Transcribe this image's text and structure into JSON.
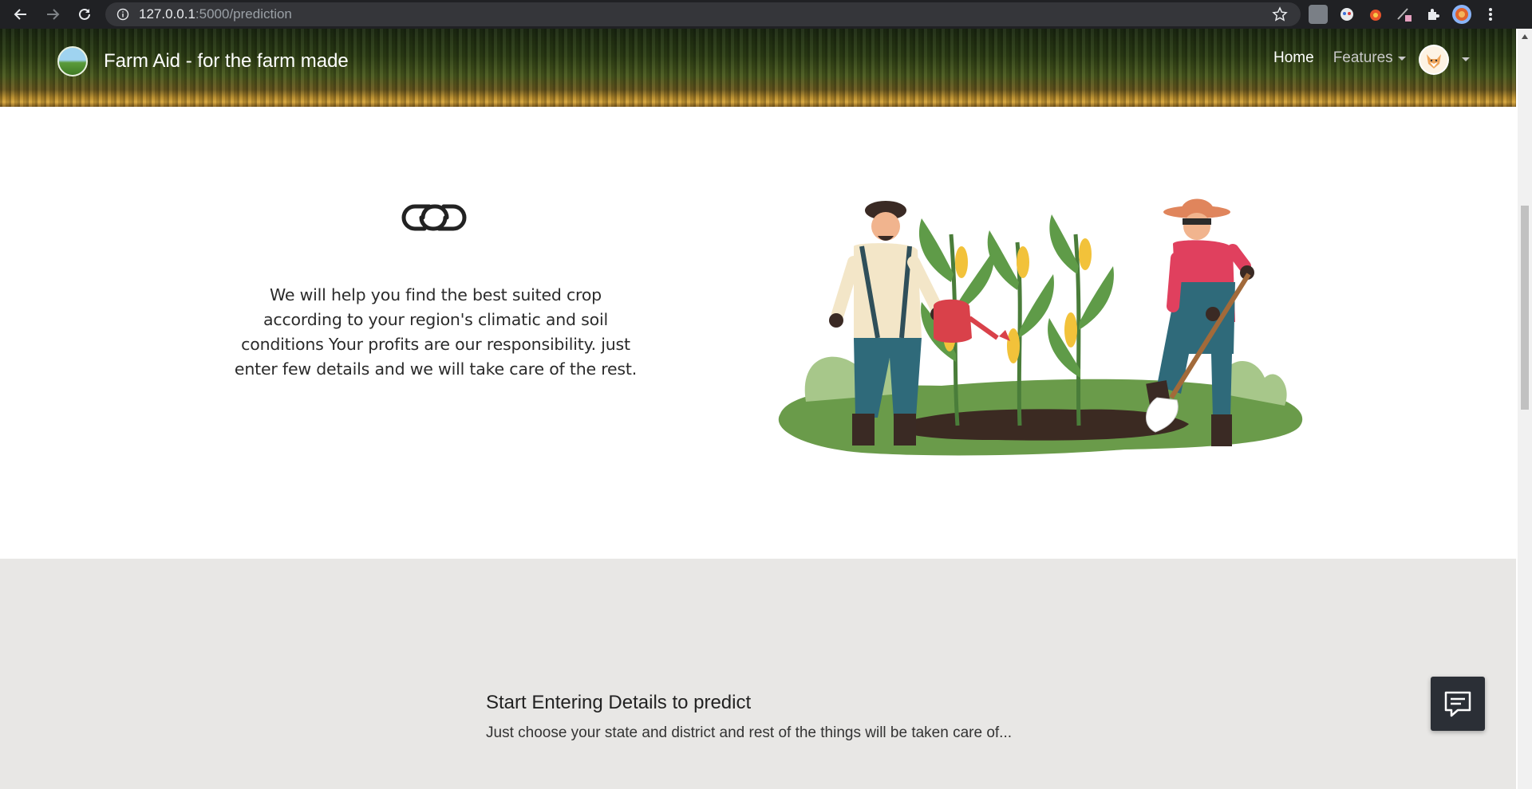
{
  "browser": {
    "url_host": "127.0.0.1",
    "url_rest": ":5000/prediction"
  },
  "navbar": {
    "brand": "Farm Aid - for the farm made",
    "home_label": "Home",
    "features_label": "Features"
  },
  "info": {
    "description": "We will help you find the best suited crop according to your region's climatic and soil conditions Your profits are our responsibility. just enter few details and we will take care of the rest."
  },
  "form_intro": {
    "title": "Start Entering Details to predict",
    "subtitle": "Just choose your state and district and rest of the things will be taken care of..."
  },
  "colors": {
    "chrome_bg": "#202124",
    "form_section_bg": "#e8e7e5",
    "chat_button_bg": "#2b2f36"
  }
}
